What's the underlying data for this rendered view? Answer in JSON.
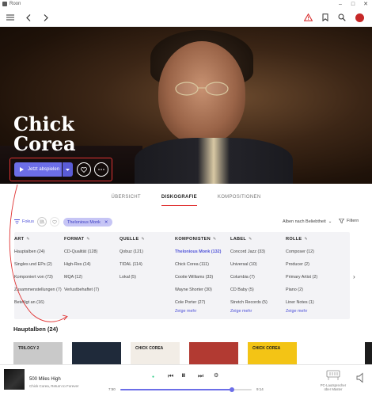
{
  "window": {
    "title": "Roon"
  },
  "hero": {
    "artist_line1": "Chick",
    "artist_line2": "Corea",
    "play_label": "Jetzt abspielen"
  },
  "tabs": [
    {
      "label": "ÜBERSICHT",
      "active": false
    },
    {
      "label": "DISKOGRAFIE",
      "active": true
    },
    {
      "label": "KOMPOSITIONEN",
      "active": false
    }
  ],
  "filter": {
    "fokus_label": "Fokus",
    "chip_label": "Thelonious Monk",
    "sort_label": "Alben nach Beliebtheit",
    "filter_label": "Filtern"
  },
  "focus_columns": [
    {
      "header": "ART",
      "items": [
        {
          "text": "Hauptalben (24)"
        },
        {
          "text": "Singles und EPs (2)"
        },
        {
          "text": "Komponiert von (73)"
        },
        {
          "text": "Zusammenstellungen (7)"
        },
        {
          "text": "Beteiligt an (16)"
        }
      ]
    },
    {
      "header": "FORMAT",
      "items": [
        {
          "text": "CD-Qualität (128)"
        },
        {
          "text": "High-Res (14)"
        },
        {
          "text": "MQA (12)"
        },
        {
          "text": "Verlustbehaftet (7)"
        }
      ]
    },
    {
      "header": "QUELLE",
      "items": [
        {
          "text": "Qobuz (121)"
        },
        {
          "text": "TIDAL (114)"
        },
        {
          "text": "Lokal (5)"
        }
      ]
    },
    {
      "header": "KOMPONISTEN",
      "items": [
        {
          "text": "Thelonious Monk (132)",
          "selected": true
        },
        {
          "text": "Chick Corea (111)"
        },
        {
          "text": "Cootie Williams (33)"
        },
        {
          "text": "Wayne Shorter (30)"
        },
        {
          "text": "Cole Porter (27)"
        },
        {
          "text": "Zeige mehr",
          "more": true
        }
      ]
    },
    {
      "header": "LABEL",
      "items": [
        {
          "text": "Concord Jazz (33)"
        },
        {
          "text": "Universal (10)"
        },
        {
          "text": "Columbia (7)"
        },
        {
          "text": "CD Baby (5)"
        },
        {
          "text": "Stretch Records (5)"
        },
        {
          "text": "Zeige mehr",
          "more": true
        }
      ]
    },
    {
      "header": "ROLLE",
      "items": [
        {
          "text": "Composer (12)"
        },
        {
          "text": "Producer (2)"
        },
        {
          "text": "Primary Artist (2)"
        },
        {
          "text": "Piano (2)"
        },
        {
          "text": "Liner Notes (1)"
        },
        {
          "text": "Zeige mehr",
          "more": true
        }
      ]
    }
  ],
  "albums_section": {
    "title": "Hauptalben (24)",
    "albums": [
      {
        "title": "TRILOGY 2",
        "bg": "#c9c9c9",
        "fg": "#2a2a2a"
      },
      {
        "title": "",
        "bg": "#1f2a3a",
        "fg": "#ffffff"
      },
      {
        "title": "CHICK COREA",
        "bg": "#f2ede6",
        "fg": "#1a1a1a"
      },
      {
        "title": "",
        "bg": "#b23a32",
        "fg": "#ffffff"
      },
      {
        "title": "CHICK COREA",
        "bg": "#f3c415",
        "fg": "#1a1a1a"
      },
      {
        "title": "",
        "bg": "#ffffff",
        "fg": "#222"
      },
      {
        "title": "",
        "bg": "#1c1c1c",
        "fg": "#ffffff"
      }
    ]
  },
  "player": {
    "track_title": "500 Miles High",
    "track_artist": "Chick Corea, Return to Forever",
    "time_elapsed": "7:50",
    "time_total": "9:14",
    "progress": 0.85,
    "zone_line1": "PC-Lautsprecher",
    "zone_line2": "über Master"
  },
  "colors": {
    "accent": "#6c6ee8",
    "annotation": "#e03333",
    "link": "#4f52d9"
  }
}
